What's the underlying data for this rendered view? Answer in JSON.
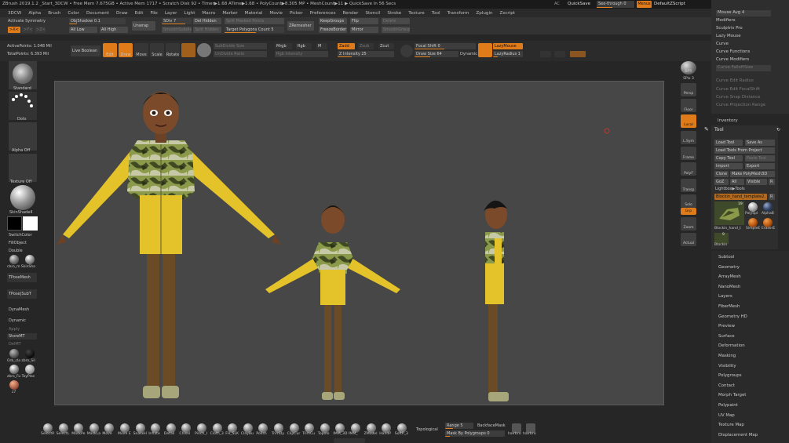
{
  "titlebar": {
    "text": "ZBrush 2019.1.2 _Start_3DCW • Free Mem 7.675GB • Active Mem 1717 • Scratch Disk 92 • Timer▶1.68 ATime▶1.68 • PolyCount▶8.305 MP • MeshCount▶11 ▶ QuickSave In 56 Secs",
    "ac": "AC",
    "quicksave": "QuickSave",
    "seethrough": "See-through 0",
    "menus": "Menus",
    "defaultzscript": "DefaultZScript"
  },
  "menubar": [
    "3DCW",
    "Alpha",
    "Brush",
    "Color",
    "Document",
    "Draw",
    "Edit",
    "File",
    "Layer",
    "Light",
    "Macro",
    "Marker",
    "Material",
    "Movie",
    "Picker",
    "Preferences",
    "Render",
    "Stencil",
    "Stroke",
    "Texture",
    "Tool",
    "Transform",
    "Zplugin",
    "Zscript"
  ],
  "toolbar1": {
    "activate_symmetry": "Activate Symmetry",
    "sym_x": ">X<",
    "sym_y": ">Y<",
    "sym_z": ">Z<",
    "obj_shadow": "ObjShadow 0.1",
    "all_low": "All Low",
    "all_high": "All High",
    "unwrap": "Unwrap",
    "sdiv": "SDiv 7",
    "smooth_subdiv": "SmoothSubdiv",
    "del_hidden": "Del Hidden",
    "split_hidden": "Split Hidden",
    "split_masked": "Split Masked Points",
    "target_polygons": "Target Polygons Count 5",
    "zremesher": "ZRemesher",
    "keepgroups": "KeepGroups",
    "freezeborder": "FreezeBorder",
    "flip": "Flip",
    "mirror": "Mirror",
    "delete": "Delete",
    "smooth_groups": "SmoothGroups"
  },
  "toolbar2": {
    "active_points": "ActivePoints: 1.048 Mil",
    "total_points": "TotalPoints: 6.393 Mil",
    "live_boolean": "Live Boolean",
    "edit": "Edit",
    "draw": "Draw",
    "move": "Move",
    "scale": "Scale",
    "rotate": "Rotate",
    "subdivide_size": "SubDivide Size",
    "undivide_ratio": "UnDivide Ratio",
    "mrgb": "Mrgb",
    "rgb": "Rgb",
    "m": "M",
    "rgb_intensity": "Rgb Intensity",
    "zadd": "Zadd",
    "zsub": "Zsub",
    "zcut": "Zcut",
    "z_intensity": "Z Intensity 25",
    "focal_shift": "Focal Shift 0",
    "draw_size": "Draw Size 64",
    "dynamic": "Dynamic",
    "lazymouse": "LazyMouse",
    "lazyradius": "LazyRadius 1"
  },
  "leftbar": {
    "standard": "Standard",
    "dots": "Dots",
    "alpha_off": "Alpha Off",
    "texture_off": "Texture Off",
    "skinshade4": "SkinShade4",
    "switchcolor": "SwitchColor",
    "fillobject": "FillObject",
    "double": "Double",
    "mat_labels": "cbro_m SkinSha",
    "tposemesh": "TPoseMesh",
    "tpose_subt": "TPose|SubT",
    "dynamesh": "DynaMesh",
    "dynamic": "Dynamic",
    "apply": "Apply",
    "storemt": "StoreMT",
    "delmt": "DelMT",
    "mat2": "Orb_cla zbro_Sil",
    "mat3": "zbro_Fu ToyPlas",
    "mat4": "z7"
  },
  "rightbar": {
    "bpr": "BPR",
    "spix": "SPix 3",
    "persp": "Persp",
    "floor": "Floor",
    "local": "Local",
    "lsym": "L.Sym",
    "frame": "Frame",
    "polyf": "PolyF",
    "transp": "Transp",
    "solo": "Solo",
    "grp": "Grp",
    "zoom": "Zoom",
    "actual": "Actual"
  },
  "right_top": {
    "items": [
      "Mouse Avg 4",
      "Modifiers",
      "Sculptris Pro",
      "Lazy Mouse",
      "Curve",
      "Curve Functions",
      "Curve Modifiers",
      "Curve Falloff",
      "Curve Edit Radius",
      "Curve Edit FocalShift",
      "Curve Snap Distance",
      "Curve Projection Range"
    ],
    "size": "Size"
  },
  "inventory": "Inventory",
  "tool": {
    "title": "Tool",
    "load_tool": "Load Tool",
    "save_as": "Save As",
    "load_from_project": "Load Tools From Project",
    "copy_tool": "Copy Tool",
    "paste_tool": "Paste Tool",
    "import": "Import",
    "export": "Export",
    "clone": "Clone",
    "make_polymesh": "Make PolyMesh3D",
    "goz": "GoZ",
    "all": "All",
    "visible": "Visible",
    "r": "R",
    "lightbox_tools": "Lightbox▶Tools",
    "current_tool": "Blockin_hand_template2. 7",
    "r2": "R",
    "thumb_count": "19",
    "thumbs": [
      "Blockin_hand_t",
      "PolySpl",
      "AlphaB",
      "SimpleE",
      "EraserE",
      "Blockin"
    ],
    "thumb_small_count": "9"
  },
  "panel_list": [
    "Subtool",
    "Geometry",
    "ArrayMesh",
    "NanoMesh",
    "Layers",
    "FiberMesh",
    "Geometry HD",
    "Preview",
    "Surface",
    "Deformation",
    "Masking",
    "Visibility",
    "Polygroups",
    "Contact",
    "Morph Target",
    "Polypaint",
    "UV Map",
    "Texture Map",
    "Displacement Map"
  ],
  "bottombar": {
    "brushes": [
      "SelectR",
      "SelectL",
      "MaskPe",
      "MaskLa",
      "Move",
      "Move E",
      "SnakeH",
      "Inflate",
      "Detail",
      "Chisel",
      "Pinch_I",
      "Cloth_3",
      "FH_SLK",
      "ClayBu",
      "Polish",
      "TrimDy",
      "ClipCur",
      "TrimCu",
      "Topolo",
      "IMM_3D",
      "IMM_",
      "ZModel",
      "HandP",
      "SoftP_3"
    ],
    "topological": "Topological",
    "range": "Range 5",
    "backfacemask": "BackfaceMask",
    "mask_by_polygroups": "Mask By Polygroups 0",
    "hairbru1": "hairbru",
    "hairbru2": "hairbru"
  }
}
